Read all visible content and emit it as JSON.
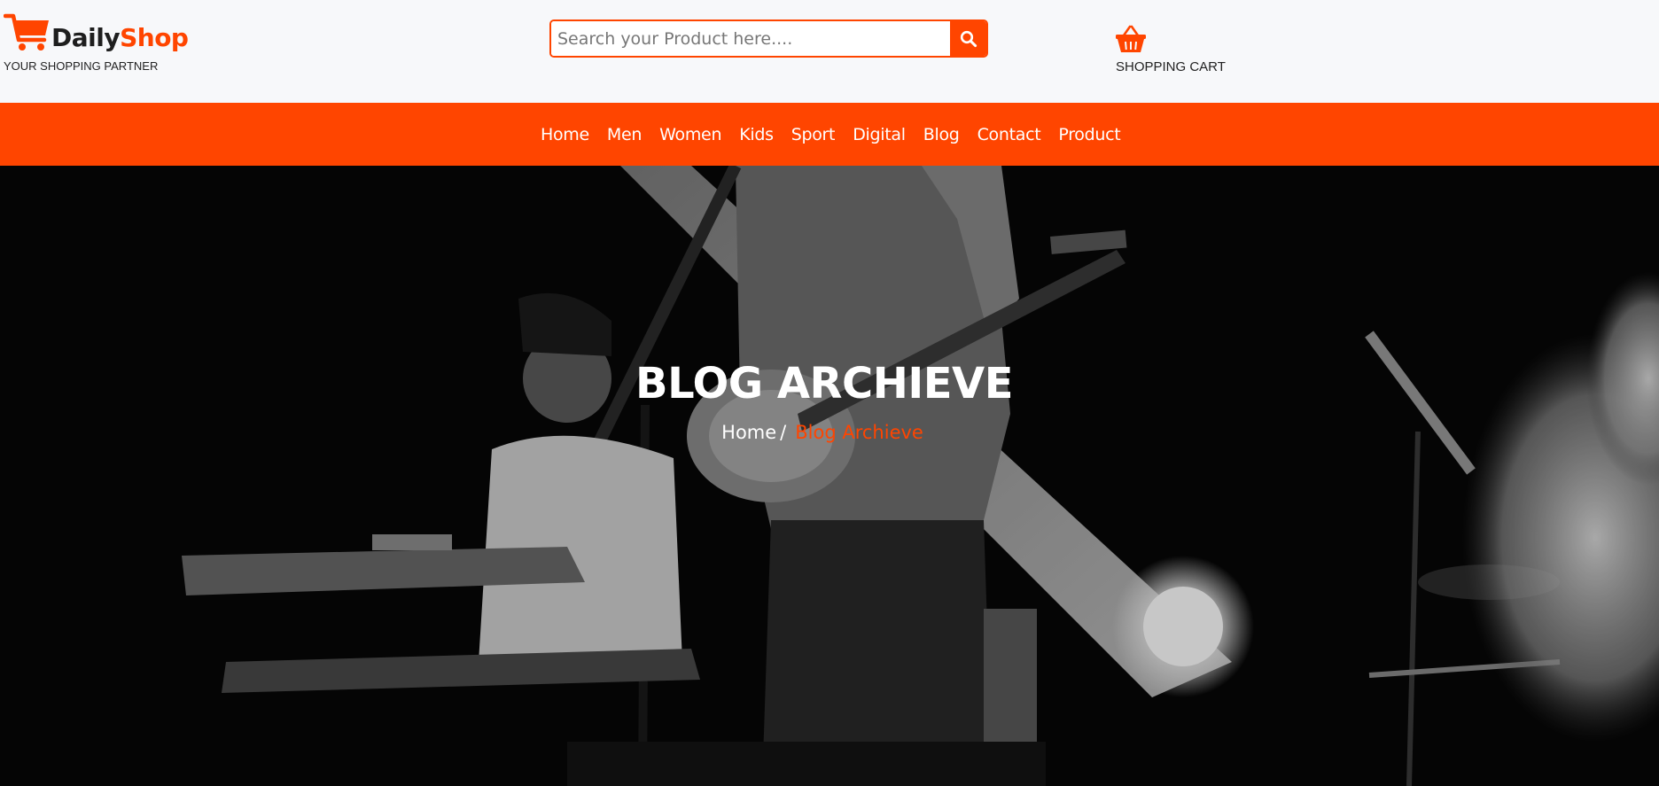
{
  "brand": {
    "name_part1": "Daily",
    "name_part2": "Shop",
    "tagline": "YOUR SHOPPING PARTNER"
  },
  "search": {
    "placeholder": "Search your Product here....",
    "value": ""
  },
  "cart": {
    "label": "SHOPPING CART"
  },
  "nav": {
    "items": [
      "Home",
      "Men",
      "Women",
      "Kids",
      "Sport",
      "Digital",
      "Blog",
      "Contact",
      "Product"
    ]
  },
  "hero": {
    "title": "BLOG ARCHIEVE",
    "breadcrumb_home": "Home",
    "breadcrumb_separator": "/",
    "breadcrumb_current": "Blog Archieve"
  },
  "colors": {
    "accent": "#ff4500",
    "header_bg": "#f7f8fa",
    "hero_bg": "#070707"
  },
  "icons": {
    "logo": "shopping-cart-icon",
    "search": "search-icon",
    "cart": "basket-icon"
  }
}
